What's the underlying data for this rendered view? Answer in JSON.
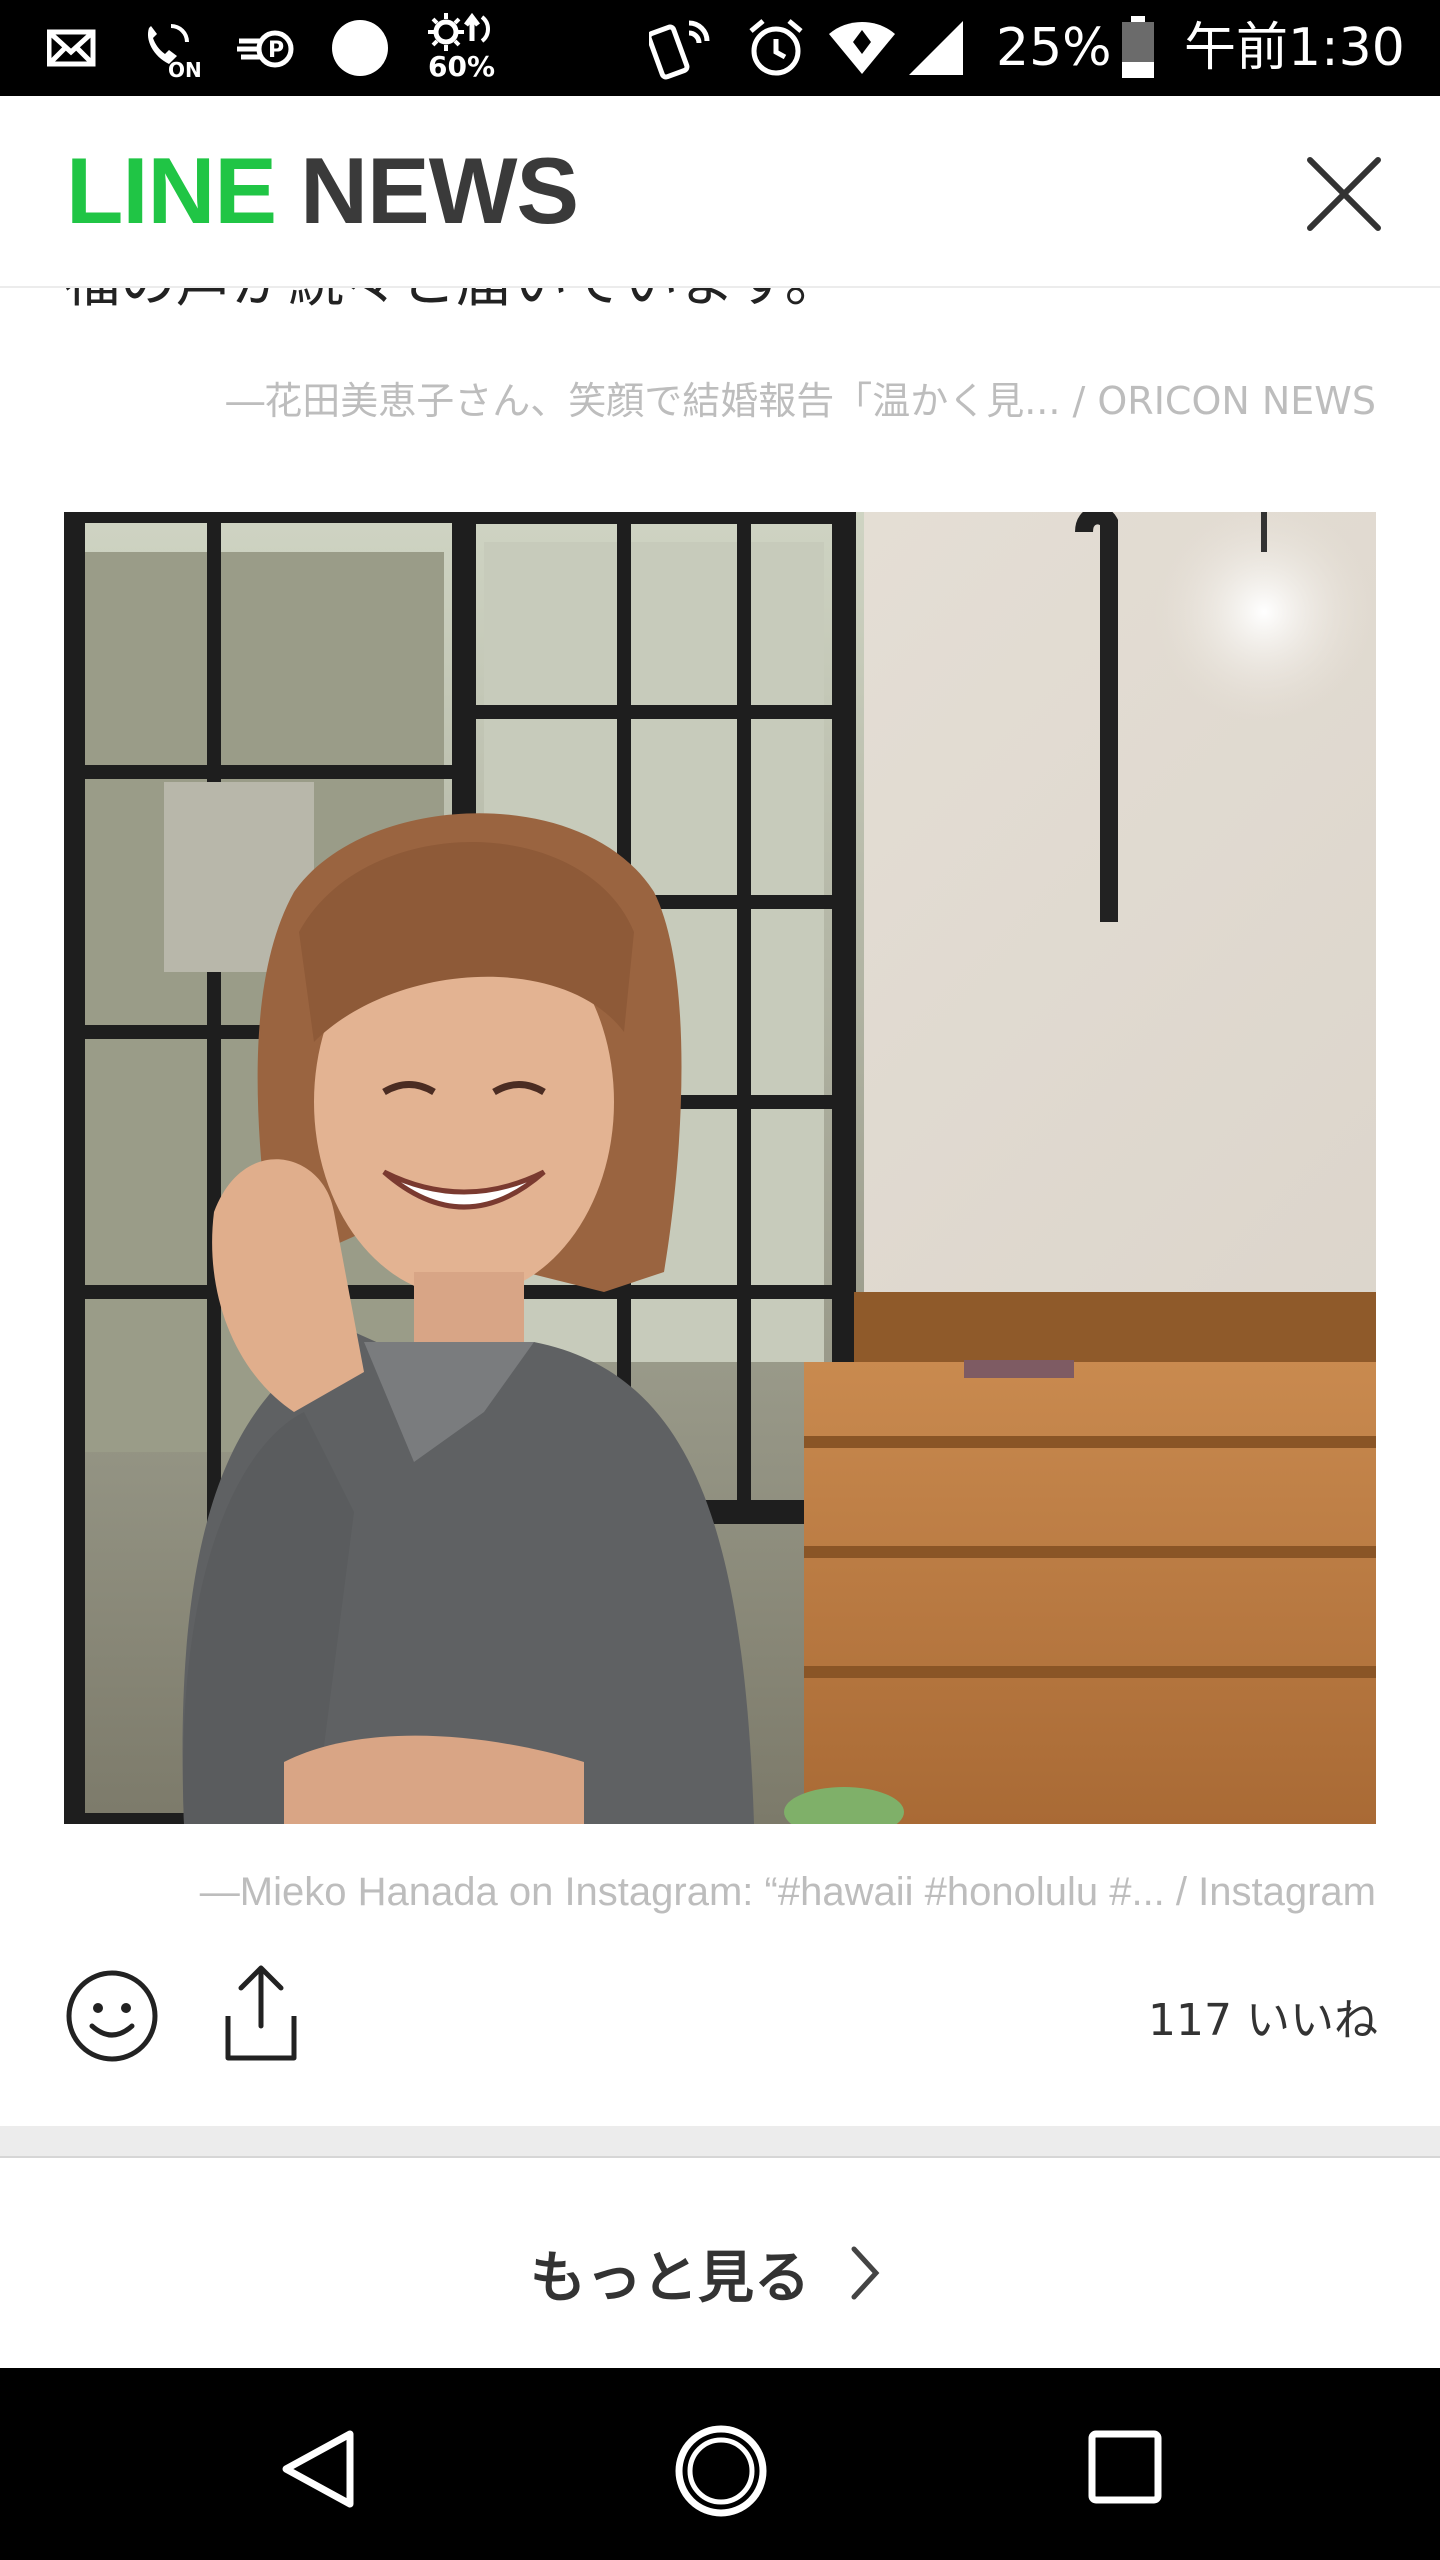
{
  "status_bar": {
    "battery_percent": "25%",
    "time": "午前1:30",
    "brightness_label": "60%",
    "on_label": "ON",
    "icons": [
      "mail-icon",
      "phone-on-icon",
      "data-saver-icon",
      "circle-icon",
      "brightness-icon",
      "nfc-icon",
      "alarm-icon",
      "wifi-icon",
      "signal-icon",
      "battery-icon"
    ]
  },
  "header": {
    "logo_line": "LINE",
    "logo_news": "NEWS",
    "close_icon": "close-icon"
  },
  "article": {
    "cut_text": "福の声が続々と届いています。",
    "source1": "―花田美恵子さん、笑顔で結婚報告「温かく見... / ORICON NEWS",
    "source2": "―Mieko Hanada on Instagram: “#hawaii #honolulu #... / Instagram"
  },
  "actions": {
    "likes": "117 いいね",
    "smile_icon": "smile-icon",
    "share_icon": "share-icon"
  },
  "more": {
    "label": "もっと見る",
    "chevron_icon": "chevron-right-icon"
  },
  "nav": {
    "icons": [
      "back-icon",
      "home-icon",
      "recents-icon"
    ]
  },
  "colors": {
    "line_green": "#20c545",
    "text_dark": "#333333",
    "caption_gray": "#bdbdbd"
  }
}
